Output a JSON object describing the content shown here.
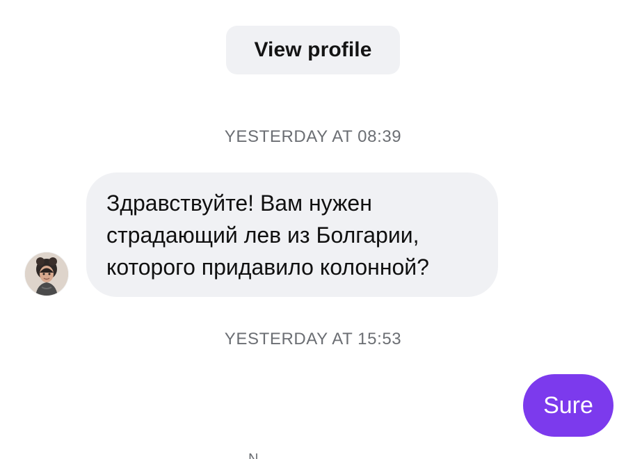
{
  "header": {
    "view_profile_label": "View profile"
  },
  "messages": [
    {
      "timestamp": "YESTERDAY AT 08:39",
      "direction": "incoming",
      "lines": [
        "Здравствуйте! Вам нужен",
        "страдающий лев из Болгарии,",
        "которого придавило колонной?"
      ]
    },
    {
      "timestamp": "YESTERDAY AT 15:53",
      "direction": "outgoing",
      "text": "Sure"
    }
  ],
  "footer": {
    "partial_text": "N"
  },
  "colors": {
    "background": "#ffffff",
    "incoming_bubble": "#f0f1f4",
    "outgoing_bubble": "#7c3aed",
    "timestamp": "#6b6e73"
  },
  "icons": {
    "avatar": "user-avatar-photo"
  }
}
